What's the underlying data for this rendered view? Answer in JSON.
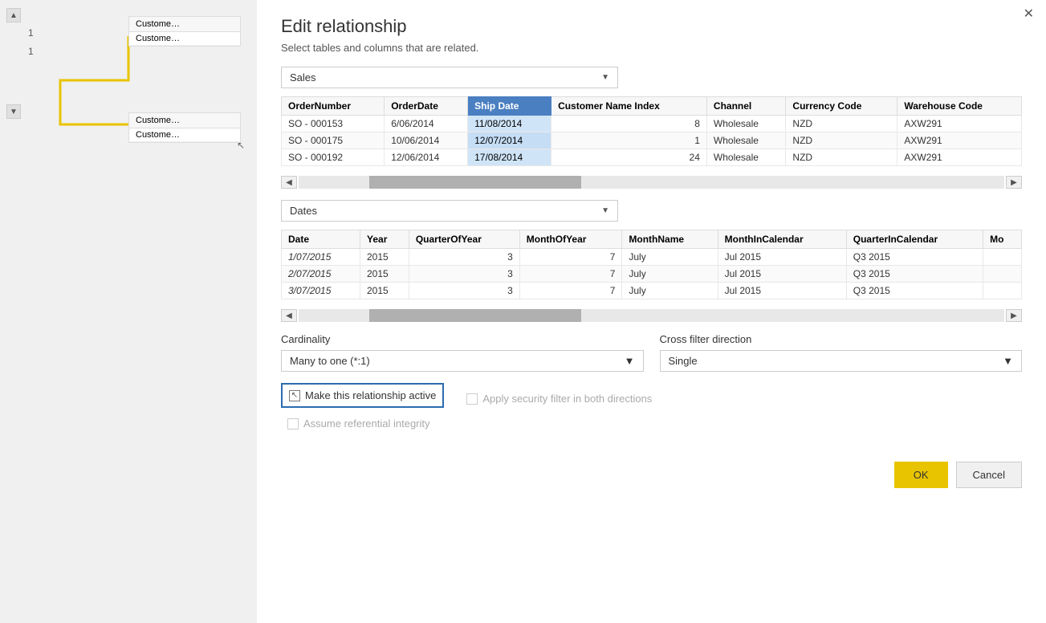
{
  "leftPanel": {
    "tables": [
      {
        "label": "Customer",
        "rows": [
          "Customer"
        ]
      },
      {
        "label": "Customer",
        "rows": [
          "Customer"
        ]
      }
    ]
  },
  "dialog": {
    "title": "Edit relationship",
    "subtitle": "Select tables and columns that are related.",
    "closeBtn": "✕",
    "table1": {
      "dropdownValue": "Sales",
      "columns": [
        {
          "name": "OrderNumber",
          "highlighted": false
        },
        {
          "name": "OrderDate",
          "highlighted": false
        },
        {
          "name": "Ship Date",
          "highlighted": true
        },
        {
          "name": "Customer Name Index",
          "highlighted": false
        },
        {
          "name": "Channel",
          "highlighted": false
        },
        {
          "name": "Currency Code",
          "highlighted": false
        },
        {
          "name": "Warehouse Code",
          "highlighted": false
        }
      ],
      "rows": [
        {
          "OrderNumber": "SO - 000153",
          "OrderDate": "6/06/2014",
          "ShipDate": "11/08/2014",
          "CustomerNameIndex": "8",
          "Channel": "Wholesale",
          "CurrencyCode": "NZD",
          "WarehouseCode": "AXW291"
        },
        {
          "OrderNumber": "SO - 000175",
          "OrderDate": "10/06/2014",
          "ShipDate": "12/07/2014",
          "CustomerNameIndex": "1",
          "Channel": "Wholesale",
          "CurrencyCode": "NZD",
          "WarehouseCode": "AXW291"
        },
        {
          "OrderNumber": "SO - 000192",
          "OrderDate": "12/06/2014",
          "ShipDate": "17/08/2014",
          "CustomerNameIndex": "24",
          "Channel": "Wholesale",
          "CurrencyCode": "NZD",
          "WarehouseCode": "AXW291"
        }
      ]
    },
    "table2": {
      "dropdownValue": "Dates",
      "columns": [
        {
          "name": "Date",
          "highlighted": false
        },
        {
          "name": "Year",
          "highlighted": false
        },
        {
          "name": "QuarterOfYear",
          "highlighted": false
        },
        {
          "name": "MonthOfYear",
          "highlighted": false
        },
        {
          "name": "MonthName",
          "highlighted": false
        },
        {
          "name": "MonthInCalendar",
          "highlighted": false
        },
        {
          "name": "QuarterInCalendar",
          "highlighted": false
        },
        {
          "name": "Mo",
          "highlighted": false
        }
      ],
      "rows": [
        {
          "Date": "1/07/2015",
          "Year": "2015",
          "QuarterOfYear": "3",
          "MonthOfYear": "7",
          "MonthName": "July",
          "MonthInCalendar": "Jul 2015",
          "QuarterInCalendar": "Q3 2015",
          "Mo": ""
        },
        {
          "Date": "2/07/2015",
          "Year": "2015",
          "QuarterOfYear": "3",
          "MonthOfYear": "7",
          "MonthName": "July",
          "MonthInCalendar": "Jul 2015",
          "QuarterInCalendar": "Q3 2015",
          "Mo": ""
        },
        {
          "Date": "3/07/2015",
          "Year": "2015",
          "QuarterOfYear": "3",
          "MonthOfYear": "7",
          "MonthName": "July",
          "MonthInCalendar": "Jul 2015",
          "QuarterInCalendar": "Q3 2015",
          "Mo": ""
        }
      ]
    },
    "cardinality": {
      "label": "Cardinality",
      "value": "Many to one (*:1)"
    },
    "crossFilterDirection": {
      "label": "Cross filter direction",
      "value": "Single"
    },
    "checkboxes": {
      "makeActive": {
        "label": "Make this relationship active",
        "checked": true
      },
      "referentialIntegrity": {
        "label": "Assume referential integrity",
        "checked": false,
        "disabled": true
      },
      "applySecurityFilter": {
        "label": "Apply security filter in both directions",
        "checked": false,
        "disabled": true
      }
    },
    "buttons": {
      "ok": "OK",
      "cancel": "Cancel"
    }
  }
}
